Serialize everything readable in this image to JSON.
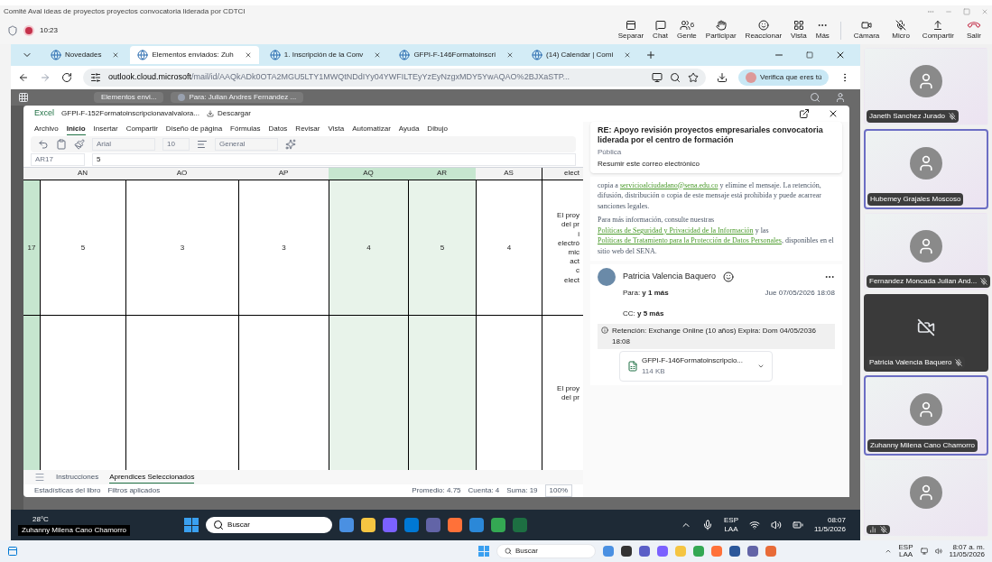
{
  "meeting": {
    "title": "Comité Aval ideas de proyectos proyectos convocatoria liderada por CDTCI",
    "recording": true,
    "time": "10:23",
    "toolbar": [
      {
        "label": "Separar",
        "kind": "popout"
      },
      {
        "label": "Chat",
        "kind": "chat"
      },
      {
        "label": "Gente",
        "kind": "people",
        "count": "6"
      },
      {
        "label": "Participar",
        "kind": "hand"
      },
      {
        "label": "Reaccionar",
        "kind": "smile"
      },
      {
        "label": "Vista",
        "kind": "grid"
      },
      {
        "label": "Más",
        "kind": "more"
      }
    ],
    "controls": [
      {
        "label": "Cámara",
        "kind": "camera"
      },
      {
        "label": "Micro",
        "kind": "mic"
      },
      {
        "label": "Compartir",
        "kind": "share"
      },
      {
        "label": "Salir",
        "kind": "leave"
      }
    ]
  },
  "browser": {
    "tabs": [
      {
        "label": "Novedades",
        "selected": false
      },
      {
        "label": "Elementos enviados: Zuh",
        "selected": true
      },
      {
        "label": "1. Inscripción de la Conv",
        "selected": false
      },
      {
        "label": "GFPI-F-146Formatoinscri",
        "selected": false
      },
      {
        "label": "(14) Calendar | Comi",
        "selected": false
      }
    ],
    "url_host": "outlook.cloud.microsoft",
    "url_path": "/mail/id/AAQkADk0OTA2MGU5LTY1MWQtNDdIYy04YWFILTEyYzEyNzgxMDY5YwAQAO%2BJXaSTP...",
    "verify": "Verifica que eres tú"
  },
  "outlook": {
    "folder": "Elementos envi...",
    "message_tab": "Para: Julian Andres Fernandez ..."
  },
  "excel": {
    "app": "Excel",
    "file": "GFPI-F-152Formatoinscripcionavalvalora...",
    "download": "Descargar",
    "ribbon_tabs": [
      {
        "label": "Archivo",
        "selected": false
      },
      {
        "label": "Inicio",
        "selected": true
      },
      {
        "label": "Insertar",
        "selected": false
      },
      {
        "label": "Compartir",
        "selected": false
      },
      {
        "label": "Diseño de página",
        "selected": false
      },
      {
        "label": "Fórmulas",
        "selected": false
      },
      {
        "label": "Datos",
        "selected": false
      },
      {
        "label": "Revisar",
        "selected": false
      },
      {
        "label": "Vista",
        "selected": false
      },
      {
        "label": "Automatizar",
        "selected": false
      },
      {
        "label": "Ayuda",
        "selected": false
      },
      {
        "label": "Dibujo",
        "selected": false
      }
    ],
    "font": "Arial",
    "font_size": "10",
    "number_format": "General",
    "cell_ref": "AR17",
    "formula": "5",
    "columns": [
      {
        "label": "AN",
        "selected": false
      },
      {
        "label": "AO",
        "selected": false
      },
      {
        "label": "AP",
        "selected": false
      },
      {
        "label": "AQ",
        "selected": true
      },
      {
        "label": "AR",
        "selected": true
      },
      {
        "label": "AS",
        "selected": false
      }
    ],
    "cut_column_top": "elect",
    "rows": [
      {
        "number": "17",
        "values": [
          "5",
          "3",
          "3",
          "4",
          "5",
          "4"
        ],
        "cut_lines": [
          "El proy",
          "del pr",
          "i",
          "electró",
          "mic",
          "act",
          "c",
          "elect"
        ]
      },
      {
        "cut_lines": [
          "El proy",
          "del pr"
        ]
      }
    ],
    "sheet_tabs": [
      {
        "label": "Instrucciones",
        "selected": false
      },
      {
        "label": "Aprendices Seleccionados",
        "selected": true
      }
    ],
    "status_left": [
      "Estadísticas del libro",
      "Filtros aplicados"
    ],
    "status_right": [
      "Promedio: 4.75",
      "Cuenta: 4",
      "Suma: 19"
    ],
    "zoom": "100%"
  },
  "email": {
    "subject": "RE: Apoyo revisión proyectos empresariales convocatoria liderada por el centro de formación",
    "label": "Pública",
    "summarize": "Resumir este correo electrónico",
    "body_1": [
      "copia a ",
      "servicioalciudadano@sena.edu.co",
      " y elimine el mensaje. La retención, difusión, distribución o copia de este mensaje está prohibida y puede acarrear sanciones legales."
    ],
    "body_2": [
      "Para más información, consulte nuestras ",
      "Políticas de Seguridad y Privacidad de la Información",
      " y las ",
      "Políticas de Tratamiento para la Protección de Datos Personales",
      ", disponibles en el sitio web del SENA."
    ],
    "sender": "Patricia Valencia Baquero",
    "to": "Para: **y 1 más**",
    "date": "Jue 07/05/2026 18:08",
    "cc": "CC: **y 5 más**",
    "retention": "Retención: Exchange Online (10 años) Expira: Dom 04/05/2036 18:08",
    "attachment": {
      "name": "GFPI-F-146Formatoinscripcio...",
      "size": "114 KB"
    }
  },
  "shared_taskbar": {
    "temperature": "28°C",
    "presenter": "Zuhanny Milena Cano Chamorro",
    "search": "Buscar",
    "lang": "ESP",
    "region": "LAA",
    "time": "08:07",
    "date": "11/5/2026"
  },
  "participants": [
    {
      "name": "Janeth Sanchez Jurado",
      "muted": true,
      "selected": false,
      "camera_off": false
    },
    {
      "name": "Hubemey Grajales Moscoso",
      "muted": false,
      "selected": true,
      "camera_off": false
    },
    {
      "name": "Fernandez Moncada Julian And...",
      "muted": true,
      "selected": false,
      "camera_off": false
    },
    {
      "name": "Patricia Valencia Baquero",
      "muted": true,
      "selected": false,
      "camera_off": true
    },
    {
      "name": "Zuhanny Milena Cano Chamorro",
      "muted": false,
      "selected": true,
      "camera_off": false
    },
    {
      "muted": true,
      "selected": false,
      "camera_off": false
    }
  ],
  "taskbar": {
    "search": "Buscar",
    "lang": "ESP",
    "region": "LAA",
    "time": "8:07 a. m.",
    "date": "11/05/2026"
  }
}
